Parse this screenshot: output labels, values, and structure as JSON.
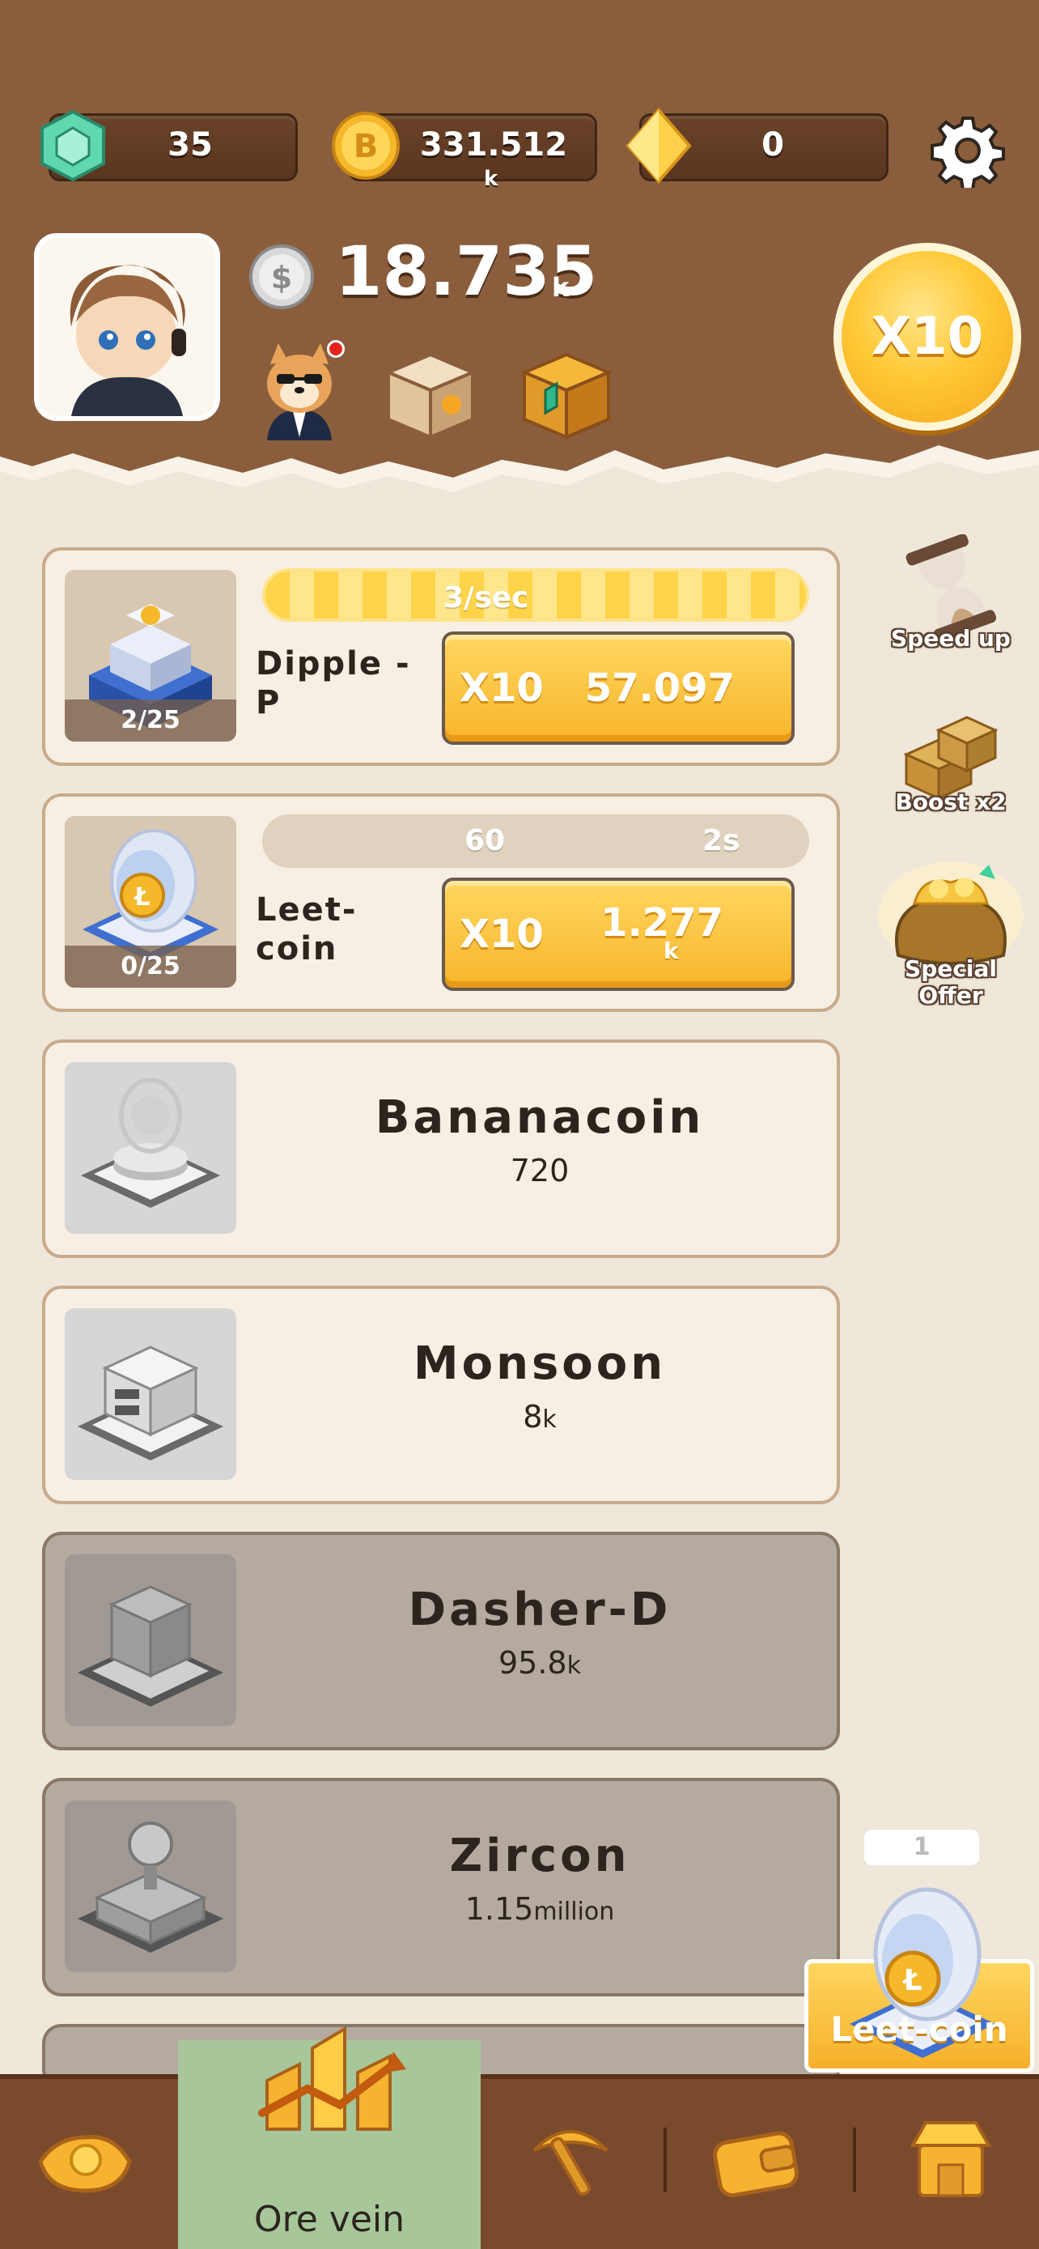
{
  "currencies": {
    "gems": "35",
    "gold": "331.512",
    "gold_unit": "k",
    "diamonds": "0"
  },
  "balance": {
    "value": "18.735",
    "unit": "k"
  },
  "boost_button": "X10",
  "miners": [
    {
      "name": "Dipple - P",
      "name_line1": "Dipple -",
      "name_line2": "P",
      "count": "2/25",
      "rate": "3/sec",
      "buy_multiplier": "X10",
      "buy_price": "57.097",
      "buy_unit": ""
    },
    {
      "name": "Leet-coin",
      "name_line1": "Leet-",
      "name_line2": "coin",
      "count": "0/25",
      "rate_left": "60",
      "rate_right": "2s",
      "progress": 0,
      "buy_multiplier": "X10",
      "buy_price": "1.277",
      "buy_unit": "k"
    },
    {
      "name": "Bananacoin",
      "price": "720",
      "price_unit": "",
      "state": "available"
    },
    {
      "name": "Monsoon",
      "price": "8",
      "price_unit": "k",
      "state": "available"
    },
    {
      "name": "Dasher-D",
      "price": "95.8",
      "price_unit": "k",
      "state": "locked"
    },
    {
      "name": "Zircon",
      "price": "1.15",
      "price_unit": "million",
      "state": "locked"
    }
  ],
  "side_buttons": {
    "speed_up": "Speed up",
    "boost": "Boost x2",
    "special_offer": "Special Offer"
  },
  "floating_coin": {
    "badge": "1",
    "label": "Leet-coin"
  },
  "nav": {
    "active_label": "Ore vein"
  },
  "colors": {
    "header": "#8a5e3c",
    "accent_gold": "#ffc937",
    "nav_active": "#a7c79b",
    "background": "#efe7da"
  }
}
